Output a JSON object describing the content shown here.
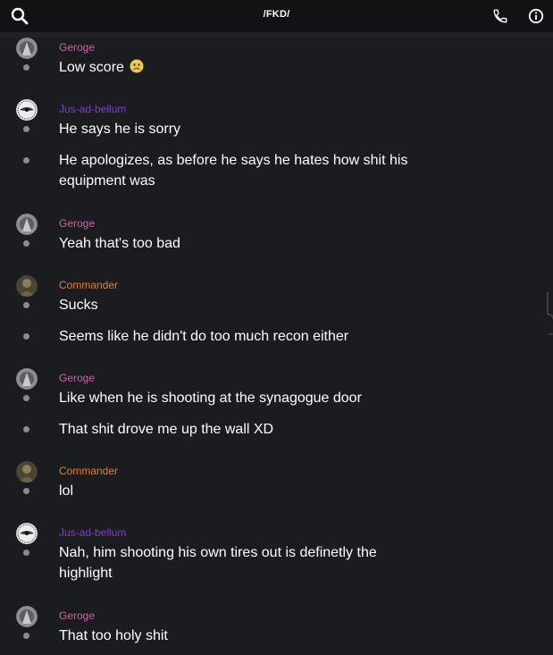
{
  "header": {
    "title": "/FKD/"
  },
  "colors": {
    "geroge": "#d55fa6",
    "jus": "#7c3fc6",
    "commander": "#e0802a",
    "background": "#1b1c1f",
    "topbar": "#111214"
  },
  "messages": [
    {
      "author": "Geroge",
      "text": "Low score"
    },
    {
      "author": "Jus-ad-bellum",
      "text": "He says he is sorry"
    },
    {
      "author": "Jus-ad-bellum",
      "text": "He apologizes, as before he says he hates how shit his equipment was"
    },
    {
      "author": "Geroge",
      "text": "Yeah that's too bad"
    },
    {
      "author": "Commander",
      "text": "Sucks"
    },
    {
      "author": "Commander",
      "text": "Seems like he didn't do too much recon either"
    },
    {
      "author": "Geroge",
      "text": "Like when he is shooting at the synagogue door"
    },
    {
      "author": "Geroge",
      "text": "That shit drove me up the wall XD"
    },
    {
      "author": "Commander",
      "text": "lol"
    },
    {
      "author": "Jus-ad-bellum",
      "text": "Nah, him shooting his own tires out is definetly the highlight"
    },
    {
      "author": "Geroge",
      "text": "That too holy shit"
    }
  ]
}
